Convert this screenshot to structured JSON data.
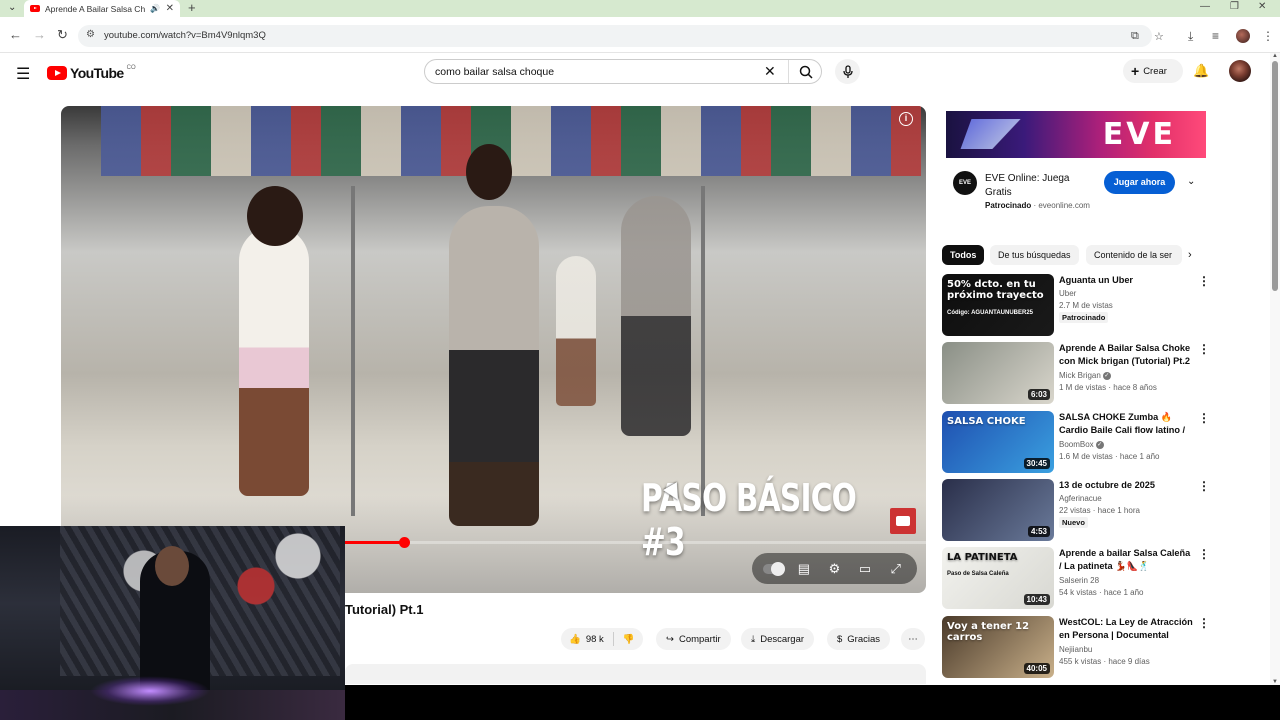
{
  "browser": {
    "tab_title": "Aprende A Bailar Salsa Cho",
    "url": "youtube.com/watch?v=Bm4V9nlqm3Q"
  },
  "header": {
    "logo_text": "YouTube",
    "country_code": "CO",
    "search_query": "como bailar salsa choque",
    "create_label": "Crear"
  },
  "video": {
    "overlay_title": "PASO BÁSICO #3",
    "title": "Tutorial) Pt.1",
    "progress": 0.396,
    "actions": {
      "likes": "98 k",
      "share": "Compartir",
      "download": "Descargar",
      "thanks": "Gracias"
    }
  },
  "ad": {
    "banner_text": "EVE",
    "icon_text": "EVE",
    "title": "EVE Online: Juega Gratis",
    "sponsored": "Patrocinado",
    "domain": "eveonline.com",
    "cta": "Jugar ahora"
  },
  "chips": [
    "Todos",
    "De tus búsquedas",
    "Contenido de la ser"
  ],
  "recommendations": [
    {
      "title": "Aguanta un Uber",
      "channel": "Uber",
      "meta": "2.7 M de vistas",
      "badge": "Patrocinado",
      "duration": "",
      "thumb_text": "50% dcto. en tu próximo trayecto",
      "thumb_sub": "Código: AGUANTAUNUBER25",
      "colors": [
        "#0d0d0d",
        "#1a1a1a"
      ]
    },
    {
      "title": "Aprende A Bailar Salsa Choke con Mick brigan (Tutorial) Pt.2",
      "channel": "Mick Brigan",
      "verified": true,
      "meta": "1 M de vistas · hace 8 años",
      "duration": "6:03",
      "colors": [
        "#8a8f86",
        "#d9d6cc"
      ]
    },
    {
      "title": "SALSA CHOKE  Zumba 🔥 Cardio Baile Cali flow latino / ...",
      "channel": "BoomBox",
      "verified": true,
      "meta": "1.6 M de vistas · hace 1 año",
      "duration": "30:45",
      "thumb_text": "SALSA CHOKE",
      "colors": [
        "#1f4fb0",
        "#3aa0e0"
      ]
    },
    {
      "title": "13 de octubre de 2025",
      "channel": "Agferinacue",
      "meta": "22 vistas · hace 1 hora",
      "badge": "Nuevo",
      "duration": "4:53",
      "colors": [
        "#2a2f4a",
        "#6a7a9a"
      ]
    },
    {
      "title": "Aprende a bailar Salsa Caleña / La patineta 💃🏽👠🕺",
      "channel": "Salserin 28",
      "meta": "54 k vistas · hace 1 año",
      "duration": "10:43",
      "thumb_text": "LA PATINETA",
      "thumb_sub": "Paso de Salsa Caleña",
      "colors": [
        "#f2f2ee",
        "#d8d8d2"
      ]
    },
    {
      "title": "WestCOL: La Ley de Atracción en Persona | Documental",
      "channel": "Nejiianbu",
      "meta": "455 k vistas · hace 9 días",
      "duration": "40:05",
      "thumb_text": "Voy a tener 12 carros",
      "colors": [
        "#4a3a2a",
        "#c9b08a"
      ]
    }
  ]
}
